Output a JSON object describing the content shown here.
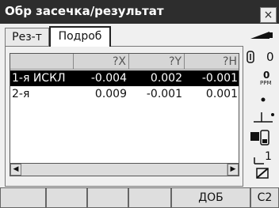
{
  "window": {
    "title": "Обр засечка/результат",
    "close_glyph": "×"
  },
  "tabs": [
    {
      "label": "Рез-т",
      "active": false
    },
    {
      "label": "Подроб",
      "active": true
    }
  ],
  "table": {
    "headers": [
      "",
      "?X",
      "?Y",
      "?H"
    ],
    "rows": [
      {
        "name": "1-я ИСКЛ",
        "x": "-0.004",
        "y": "0.002",
        "h": "-0.001",
        "selected": true
      },
      {
        "name": "2-я",
        "x": "0.009",
        "y": "-0.001",
        "h": "0.001",
        "selected": false
      }
    ]
  },
  "status": {
    "ppm_value": "0",
    "ppm_unit": "PPM",
    "prism_constant": "0",
    "target_number": "1"
  },
  "softkeys": [
    "",
    "",
    "",
    "",
    "ДОБ",
    "C2"
  ],
  "colors": {
    "titlebar": "#2d2d2d",
    "selected_row": "#000000",
    "header": "#d6d6d6"
  }
}
